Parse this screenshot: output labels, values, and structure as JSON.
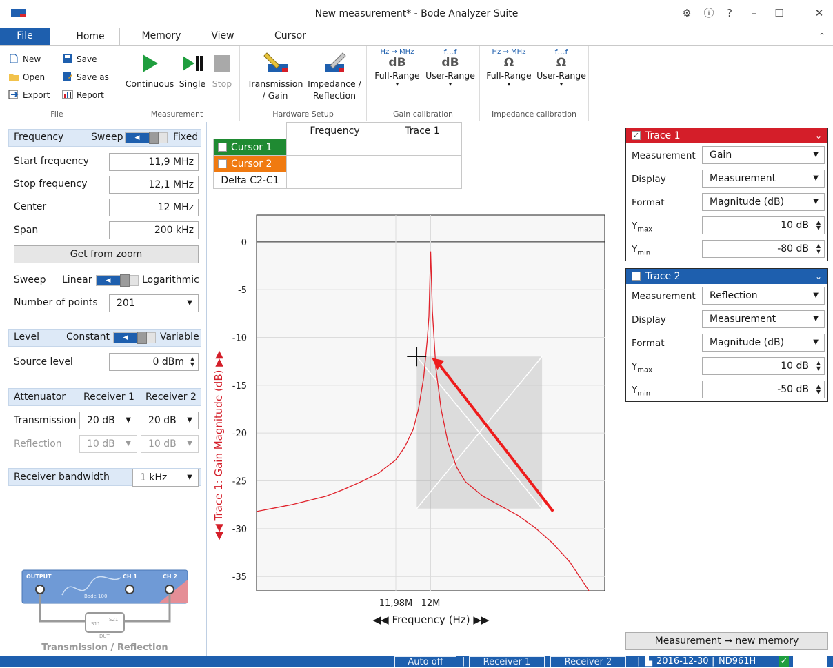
{
  "window": {
    "title": "New measurement* - Bode Analyzer Suite"
  },
  "tabs": [
    "File",
    "Home",
    "Memory",
    "View",
    "Cursor"
  ],
  "ribbon": {
    "file_group": {
      "label": "File",
      "new": "New",
      "save": "Save",
      "open": "Open",
      "save_as": "Save as",
      "export": "Export",
      "report": "Report"
    },
    "measurement_group": {
      "label": "Measurement",
      "continuous": "Continuous",
      "single": "Single",
      "stop": "Stop"
    },
    "hardware_group": {
      "label": "Hardware Setup",
      "transmission_line1": "Transmission",
      "transmission_line2": "/ Gain",
      "impedance_line1": "Impedance /",
      "impedance_line2": "Reflection"
    },
    "gain_cal_group": {
      "label": "Gain calibration",
      "full_range": "Full-Range",
      "user_range": "User-Range",
      "hz_mhz": "Hz → MHz",
      "f_range": "f…f",
      "unit": "dB"
    },
    "impedance_cal_group": {
      "label": "Impedance calibration",
      "full_range": "Full-Range",
      "user_range": "User-Range",
      "hz_mhz": "Hz → MHz",
      "f_range": "f…f",
      "unit": "Ω"
    }
  },
  "left": {
    "frequency_label": "Frequency",
    "sweep_label": "Sweep",
    "fixed_label": "Fixed",
    "start_label": "Start frequency",
    "start_value": "11,9 MHz",
    "stop_label": "Stop frequency",
    "stop_value": "12,1 MHz",
    "center_label": "Center",
    "center_value": "12 MHz",
    "span_label": "Span",
    "span_value": "200 kHz",
    "get_from_zoom": "Get from zoom",
    "sweep_mode_label": "Sweep",
    "linear": "Linear",
    "logarithmic": "Logarithmic",
    "points_label": "Number of points",
    "points_value": "201",
    "level_label": "Level",
    "constant": "Constant",
    "variable": "Variable",
    "source_level_label": "Source level",
    "source_level_value": "0 dBm",
    "attenuator_label": "Attenuator",
    "receiver1": "Receiver 1",
    "receiver2": "Receiver 2",
    "transmission_label": "Transmission",
    "trans_r1": "20 dB",
    "trans_r2": "20 dB",
    "reflection_label": "Reflection",
    "refl_r1": "10 dB",
    "refl_r2": "10 dB",
    "rbw_label": "Receiver bandwidth",
    "rbw_value": "1 kHz",
    "diagram": {
      "output": "OUTPUT",
      "ch1": "CH 1",
      "ch2": "CH 2",
      "device": "Bode 100",
      "dut": "DUT",
      "s11": "S11",
      "s21": "S21",
      "caption": "Transmission / Reflection"
    }
  },
  "cursor_table": {
    "headers": [
      "",
      "Frequency",
      "Trace 1"
    ],
    "rows": [
      {
        "label": "Cursor 1",
        "frequency": "",
        "trace1": ""
      },
      {
        "label": "Cursor 2",
        "frequency": "",
        "trace1": ""
      },
      {
        "label": "Delta C2-C1",
        "frequency": "",
        "trace1": ""
      }
    ]
  },
  "chart_data": {
    "type": "line",
    "xlabel": "Frequency (Hz)",
    "ylabel": "Trace 1: Gain Magnitude (dB)",
    "xlim": [
      11.9,
      12.1
    ],
    "ylim": [
      -36.5,
      2.8
    ],
    "y_ticks": [
      0,
      -5,
      -10,
      -15,
      -20,
      -25,
      -30,
      -35
    ],
    "x_ticks": [
      {
        "value": 11.98,
        "label": "11,98M"
      },
      {
        "value": 12.0,
        "label": "12M"
      }
    ],
    "grid": true,
    "series": [
      {
        "color": "#e0222b",
        "x": [
          11.9,
          11.92,
          11.94,
          11.95,
          11.96,
          11.97,
          11.98,
          11.985,
          11.99,
          11.993,
          11.996,
          11.998,
          11.999,
          12.0,
          12.001,
          12.003,
          12.006,
          12.01,
          12.015,
          12.02,
          12.03,
          12.04,
          12.05,
          12.06,
          12.07,
          12.08,
          12.1
        ],
        "y": [
          -28.2,
          -27.5,
          -26.6,
          -25.9,
          -25.1,
          -24.2,
          -22.8,
          -21.5,
          -19.6,
          -17.5,
          -14.2,
          -10.4,
          -7.8,
          -1.0,
          -7.2,
          -13.2,
          -17.5,
          -21.0,
          -23.6,
          -25.1,
          -26.6,
          -27.6,
          -28.6,
          -29.9,
          -31.5,
          -33.5,
          -39.0
        ]
      }
    ],
    "zoom_box": {
      "x": [
        11.992,
        12.064
      ],
      "y": [
        -12.0,
        -27.9
      ]
    }
  },
  "traces": [
    {
      "name": "Trace 1",
      "color": "#d41e29",
      "checked": true,
      "measurement": "Gain",
      "display": "Measurement",
      "format": "Magnitude (dB)",
      "ymax": "10 dB",
      "ymin": "-80 dB"
    },
    {
      "name": "Trace 2",
      "color": "#1e5fae",
      "checked": false,
      "measurement": "Reflection",
      "display": "Measurement",
      "format": "Magnitude (dB)",
      "ymax": "10 dB",
      "ymin": "-50 dB"
    }
  ],
  "trace_labels": {
    "measurement": "Measurement",
    "display": "Display",
    "format": "Format",
    "y": "Y",
    "max": "max",
    "min": "min"
  },
  "new_memory_button": "Measurement → new memory",
  "status": {
    "auto_off": "Auto off",
    "receiver1": "Receiver 1",
    "receiver2": "Receiver 2",
    "date": "2016-12-30",
    "device": "ND961H"
  }
}
